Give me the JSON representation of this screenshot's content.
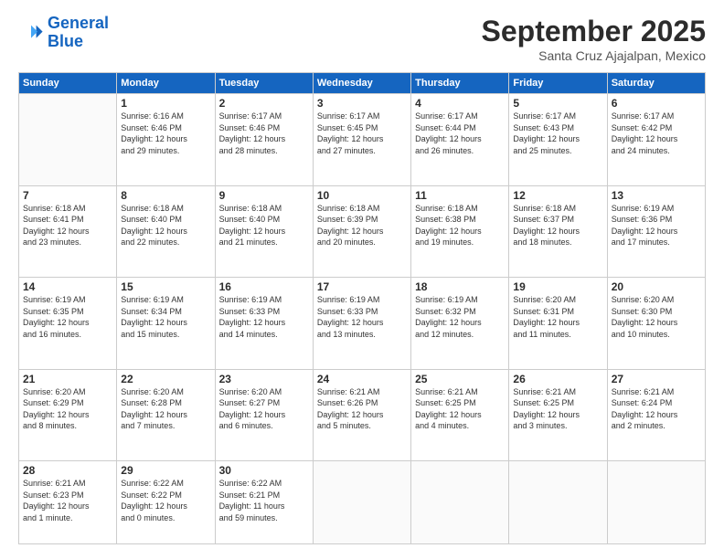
{
  "header": {
    "logo_line1": "General",
    "logo_line2": "Blue",
    "month": "September 2025",
    "location": "Santa Cruz Ajajalpan, Mexico"
  },
  "weekdays": [
    "Sunday",
    "Monday",
    "Tuesday",
    "Wednesday",
    "Thursday",
    "Friday",
    "Saturday"
  ],
  "weeks": [
    [
      {
        "day": "",
        "info": ""
      },
      {
        "day": "1",
        "info": "Sunrise: 6:16 AM\nSunset: 6:46 PM\nDaylight: 12 hours\nand 29 minutes."
      },
      {
        "day": "2",
        "info": "Sunrise: 6:17 AM\nSunset: 6:46 PM\nDaylight: 12 hours\nand 28 minutes."
      },
      {
        "day": "3",
        "info": "Sunrise: 6:17 AM\nSunset: 6:45 PM\nDaylight: 12 hours\nand 27 minutes."
      },
      {
        "day": "4",
        "info": "Sunrise: 6:17 AM\nSunset: 6:44 PM\nDaylight: 12 hours\nand 26 minutes."
      },
      {
        "day": "5",
        "info": "Sunrise: 6:17 AM\nSunset: 6:43 PM\nDaylight: 12 hours\nand 25 minutes."
      },
      {
        "day": "6",
        "info": "Sunrise: 6:17 AM\nSunset: 6:42 PM\nDaylight: 12 hours\nand 24 minutes."
      }
    ],
    [
      {
        "day": "7",
        "info": "Sunrise: 6:18 AM\nSunset: 6:41 PM\nDaylight: 12 hours\nand 23 minutes."
      },
      {
        "day": "8",
        "info": "Sunrise: 6:18 AM\nSunset: 6:40 PM\nDaylight: 12 hours\nand 22 minutes."
      },
      {
        "day": "9",
        "info": "Sunrise: 6:18 AM\nSunset: 6:40 PM\nDaylight: 12 hours\nand 21 minutes."
      },
      {
        "day": "10",
        "info": "Sunrise: 6:18 AM\nSunset: 6:39 PM\nDaylight: 12 hours\nand 20 minutes."
      },
      {
        "day": "11",
        "info": "Sunrise: 6:18 AM\nSunset: 6:38 PM\nDaylight: 12 hours\nand 19 minutes."
      },
      {
        "day": "12",
        "info": "Sunrise: 6:18 AM\nSunset: 6:37 PM\nDaylight: 12 hours\nand 18 minutes."
      },
      {
        "day": "13",
        "info": "Sunrise: 6:19 AM\nSunset: 6:36 PM\nDaylight: 12 hours\nand 17 minutes."
      }
    ],
    [
      {
        "day": "14",
        "info": "Sunrise: 6:19 AM\nSunset: 6:35 PM\nDaylight: 12 hours\nand 16 minutes."
      },
      {
        "day": "15",
        "info": "Sunrise: 6:19 AM\nSunset: 6:34 PM\nDaylight: 12 hours\nand 15 minutes."
      },
      {
        "day": "16",
        "info": "Sunrise: 6:19 AM\nSunset: 6:33 PM\nDaylight: 12 hours\nand 14 minutes."
      },
      {
        "day": "17",
        "info": "Sunrise: 6:19 AM\nSunset: 6:33 PM\nDaylight: 12 hours\nand 13 minutes."
      },
      {
        "day": "18",
        "info": "Sunrise: 6:19 AM\nSunset: 6:32 PM\nDaylight: 12 hours\nand 12 minutes."
      },
      {
        "day": "19",
        "info": "Sunrise: 6:20 AM\nSunset: 6:31 PM\nDaylight: 12 hours\nand 11 minutes."
      },
      {
        "day": "20",
        "info": "Sunrise: 6:20 AM\nSunset: 6:30 PM\nDaylight: 12 hours\nand 10 minutes."
      }
    ],
    [
      {
        "day": "21",
        "info": "Sunrise: 6:20 AM\nSunset: 6:29 PM\nDaylight: 12 hours\nand 8 minutes."
      },
      {
        "day": "22",
        "info": "Sunrise: 6:20 AM\nSunset: 6:28 PM\nDaylight: 12 hours\nand 7 minutes."
      },
      {
        "day": "23",
        "info": "Sunrise: 6:20 AM\nSunset: 6:27 PM\nDaylight: 12 hours\nand 6 minutes."
      },
      {
        "day": "24",
        "info": "Sunrise: 6:21 AM\nSunset: 6:26 PM\nDaylight: 12 hours\nand 5 minutes."
      },
      {
        "day": "25",
        "info": "Sunrise: 6:21 AM\nSunset: 6:25 PM\nDaylight: 12 hours\nand 4 minutes."
      },
      {
        "day": "26",
        "info": "Sunrise: 6:21 AM\nSunset: 6:25 PM\nDaylight: 12 hours\nand 3 minutes."
      },
      {
        "day": "27",
        "info": "Sunrise: 6:21 AM\nSunset: 6:24 PM\nDaylight: 12 hours\nand 2 minutes."
      }
    ],
    [
      {
        "day": "28",
        "info": "Sunrise: 6:21 AM\nSunset: 6:23 PM\nDaylight: 12 hours\nand 1 minute."
      },
      {
        "day": "29",
        "info": "Sunrise: 6:22 AM\nSunset: 6:22 PM\nDaylight: 12 hours\nand 0 minutes."
      },
      {
        "day": "30",
        "info": "Sunrise: 6:22 AM\nSunset: 6:21 PM\nDaylight: 11 hours\nand 59 minutes."
      },
      {
        "day": "",
        "info": ""
      },
      {
        "day": "",
        "info": ""
      },
      {
        "day": "",
        "info": ""
      },
      {
        "day": "",
        "info": ""
      }
    ]
  ]
}
